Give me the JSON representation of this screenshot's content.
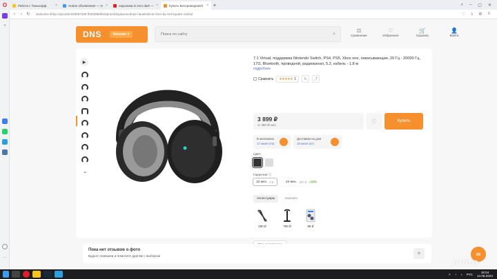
{
  "browser": {
    "tabs": [
      {
        "label": "Работа с Тинькофф",
        "color": "#f5c518"
      },
      {
        "label": "Новое объявление — О",
        "color": "#3d9bf0"
      },
      {
        "label": "наушники ie zero dark —",
        "color": "#e01f2b"
      },
      {
        "label": "Купить Беспроводная/п",
        "color": "#f68f2d",
        "active": true
      }
    ],
    "new_tab": "+",
    "url": "www.dns-shop.ru/product/20b97236 fb30d56d/besprovodnyeprovodnye-naushniki-ie-zero-by-red-square-camry/"
  },
  "header": {
    "brand": "DNS",
    "catalog": "Каталог",
    "search_placeholder": "Поиск по сайту",
    "actions": [
      {
        "icon": "compare-icon",
        "glyph": "⚖",
        "label": "Сравнение"
      },
      {
        "icon": "heart-icon",
        "glyph": "♡",
        "label": "Избранное"
      },
      {
        "icon": "cart-icon",
        "glyph": "🛒",
        "label": "Корзина"
      },
      {
        "icon": "user-icon",
        "glyph": "👤",
        "label": "Войти"
      }
    ]
  },
  "product": {
    "title": "7.1 Virtual, поддержка Nintendo Switch, PS4, PS5, Xbox one, охватывающие, 20 Гц - 20000 Гц, 17Ω, Bluetooth, проводной, радиоканал, 5.2, кабель - 1.8 м",
    "more": "подробнее",
    "compare": "Сравнить",
    "rating_stars": "★★★★★",
    "reviews_count": "1",
    "price": "3 899 ₽",
    "credit": "от 380 ₽/ мес.",
    "buy": "Купить",
    "availability": [
      {
        "line1": "В магазинах",
        "line2": "17 июня (пн)"
      },
      {
        "line1": "Доставим на дом",
        "line2": "18 июня (вт)"
      }
    ],
    "color_label": "Цвет",
    "warranty_label": "Гарантия ⓘ",
    "warranty": [
      {
        "label": "12 мес.",
        "price": "0 ₽"
      },
      {
        "label": "24 мес.",
        "price": "307 ₽",
        "badge": "-40%"
      }
    ],
    "tabs": [
      "Аксессуары",
      "Аналоги"
    ],
    "accessories": [
      {
        "price": "250 ₽"
      },
      {
        "price": "750 ₽"
      },
      {
        "price": "99 ₽"
      }
    ],
    "all_accessories": "Все аксессуары"
  },
  "reviews": {
    "title": "Пока нет отзывов о фото",
    "subtitle": "Будьте первыми и помогите другим с выбором",
    "add": "+"
  },
  "watermark": "Avito",
  "taskbar": {
    "lang": "РУС",
    "time": "18:04",
    "date": "14.06.2024"
  },
  "colors": {
    "accent": "#f68f2d",
    "link": "#5575c8"
  }
}
